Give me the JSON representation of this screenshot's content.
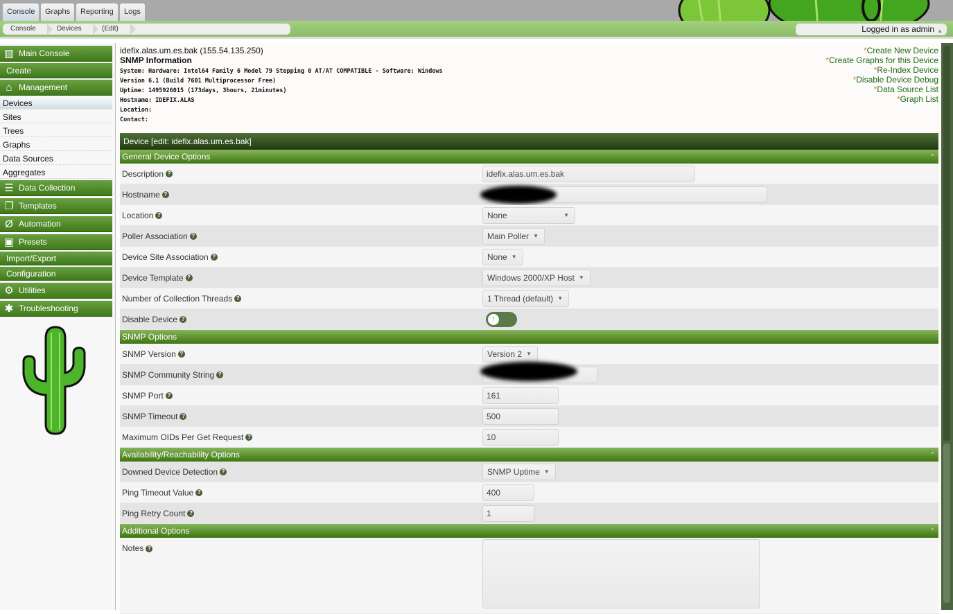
{
  "top_tabs": [
    {
      "label": "Console",
      "active": true
    },
    {
      "label": "Graphs"
    },
    {
      "label": "Reporting"
    },
    {
      "label": "Logs"
    }
  ],
  "breadcrumb": [
    "Console",
    "Devices",
    "(Edit)"
  ],
  "user_menu": "Logged in as admin",
  "sidebar": {
    "main_console": "Main Console",
    "create": "Create",
    "management": "Management",
    "management_items": [
      "Devices",
      "Sites",
      "Trees",
      "Graphs",
      "Data Sources",
      "Aggregates"
    ],
    "data_collection": "Data Collection",
    "templates": "Templates",
    "automation": "Automation",
    "presets": "Presets",
    "import_export": "Import/Export",
    "configuration": "Configuration",
    "utilities": "Utilities",
    "troubleshooting": "Troubleshooting"
  },
  "device_header": {
    "title": "idefix.alas.um.es.bak (155.54.135.250)",
    "snmp_heading": "SNMP Information",
    "snmp_lines": [
      "System: Hardware: Intel64 Family 6 Model 79 Stepping 0 AT/AT COMPATIBLE - Software: Windows",
      "Version 6.1 (Build 7601 Multiprocessor Free)",
      "Uptime: 1495926015 (173days, 3hours, 21minutes)",
      "Hostname: IDEFIX.ALAS",
      "Location:",
      "Contact:"
    ]
  },
  "actions": [
    "Create New Device",
    "Create Graphs for this Device",
    "Re-Index Device",
    "Disable Device Debug",
    "Data Source List",
    "Graph List"
  ],
  "form": {
    "title": "Device [edit: idefix.alas.um.es.bak]",
    "sections": {
      "general": "General Device Options",
      "snmp": "SNMP Options",
      "avail": "Availability/Reachability Options",
      "additional": "Additional Options"
    },
    "fields": {
      "description": {
        "label": "Description",
        "value": "idefix.alas.um.es.bak"
      },
      "hostname": {
        "label": "Hostname"
      },
      "location": {
        "label": "Location",
        "value": "None"
      },
      "poller": {
        "label": "Poller Association",
        "value": "Main Poller"
      },
      "site": {
        "label": "Device Site Association",
        "value": "None"
      },
      "template": {
        "label": "Device Template",
        "value": "Windows 2000/XP Host"
      },
      "threads": {
        "label": "Number of Collection Threads",
        "value": "1 Thread (default)"
      },
      "disable": {
        "label": "Disable Device",
        "value": false
      },
      "snmp_version": {
        "label": "SNMP Version",
        "value": "Version 2"
      },
      "community": {
        "label": "SNMP Community String"
      },
      "snmp_port": {
        "label": "SNMP Port",
        "value": "161"
      },
      "snmp_timeout": {
        "label": "SNMP Timeout",
        "value": "500"
      },
      "max_oids": {
        "label": "Maximum OIDs Per Get Request",
        "value": "10"
      },
      "downed": {
        "label": "Downed Device Detection",
        "value": "SNMP Uptime"
      },
      "ping_timeout": {
        "label": "Ping Timeout Value",
        "value": "400"
      },
      "ping_retry": {
        "label": "Ping Retry Count",
        "value": "1"
      },
      "notes": {
        "label": "Notes",
        "value": ""
      }
    }
  },
  "colors": {
    "accent_green": "#3e7611",
    "header_dark": "#203a0e",
    "link": "#1d6b14"
  }
}
